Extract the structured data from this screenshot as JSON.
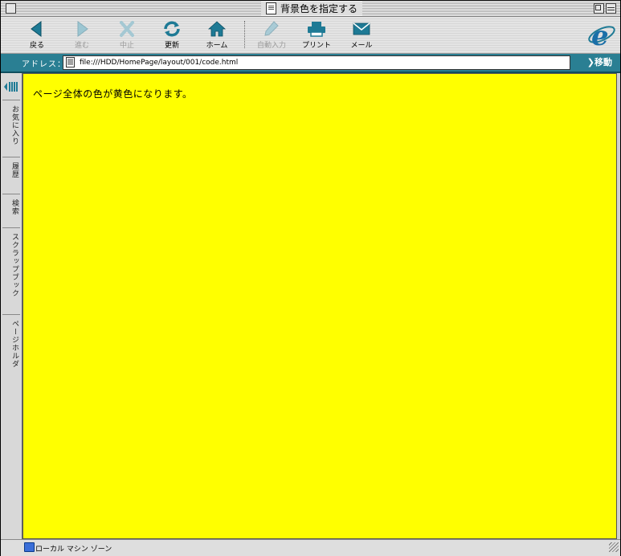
{
  "window": {
    "title": "背景色を指定する"
  },
  "toolbar": {
    "back": "戻る",
    "forward": "進む",
    "stop": "中止",
    "refresh": "更新",
    "home": "ホーム",
    "autofill": "自動入力",
    "print": "プリント",
    "mail": "メール"
  },
  "address": {
    "label": "アドレス：",
    "value": "file:///HDD/HomePage/layout/001/code.html",
    "go": "移動"
  },
  "sidebar": {
    "tabs": [
      "お気に入り",
      "履歴",
      "検索",
      "スクラップブック",
      "ページホルダ"
    ]
  },
  "page": {
    "text": "ページ全体の色が黄色になります。",
    "background": "#ffff00"
  },
  "status": {
    "zone": "ローカル マシン ゾーン"
  },
  "colors": {
    "accent": "#2a7f93",
    "icon": "#1e7a95"
  }
}
